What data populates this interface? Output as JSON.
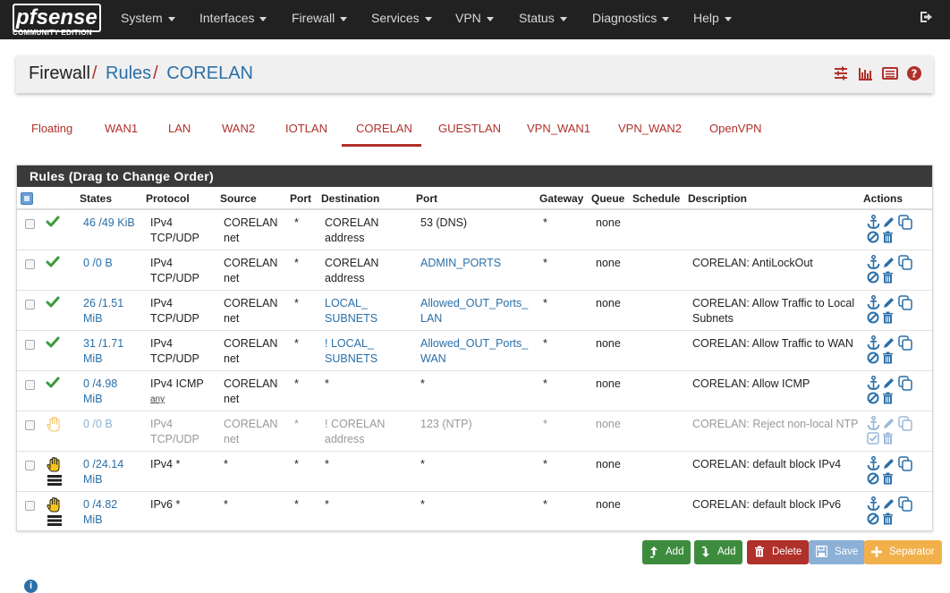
{
  "brand": {
    "logo_text": "pfsense",
    "edition": "COMMUNITY EDITION"
  },
  "nav": [
    {
      "label": "System"
    },
    {
      "label": "Interfaces"
    },
    {
      "label": "Firewall"
    },
    {
      "label": "Services"
    },
    {
      "label": "VPN"
    },
    {
      "label": "Status"
    },
    {
      "label": "Diagnostics"
    },
    {
      "label": "Help"
    }
  ],
  "breadcrumb": {
    "root": "Firewall",
    "section": "Rules",
    "current": "CORELAN"
  },
  "tabs": [
    "Floating",
    "WAN1",
    "LAN",
    "WAN2",
    "IOTLAN",
    "CORELAN",
    "GUESTLAN",
    "VPN_WAN1",
    "VPN_WAN2",
    "OpenVPN"
  ],
  "active_tab": "CORELAN",
  "panel_title": "Rules (Drag to Change Order)",
  "columns": {
    "states": "States",
    "protocol": "Protocol",
    "source": "Source",
    "port": "Port",
    "destination": "Destination",
    "dport": "Port",
    "gateway": "Gateway",
    "queue": "Queue",
    "schedule": "Schedule",
    "description": "Description",
    "actions": "Actions"
  },
  "rules": [
    {
      "status": "pass",
      "states1": "46 /49 KiB",
      "states2": "",
      "proto1": "IPv4",
      "proto2": "TCP/UDP",
      "src1": "CORELAN",
      "src2": "net",
      "sport": "*",
      "dst1": "CORELAN",
      "dst2": "address",
      "dport1": "53 (DNS)",
      "dport2": "",
      "gateway": "*",
      "queue": "none",
      "desc1": "",
      "desc2": ""
    },
    {
      "status": "pass",
      "states1": "0 /0 B",
      "states2": "",
      "proto1": "IPv4",
      "proto2": "TCP/UDP",
      "src1": "CORELAN",
      "src2": "net",
      "sport": "*",
      "dst1": "CORELAN",
      "dst2": "address",
      "dport1": "ADMIN_PORTS",
      "dport2": "",
      "gateway": "*",
      "queue": "none",
      "desc1": "CORELAN: AntiLockOut",
      "desc2": ""
    },
    {
      "status": "pass",
      "states1": "26 /1.51",
      "states2": "MiB",
      "proto1": "IPv4",
      "proto2": "TCP/UDP",
      "src1": "CORELAN",
      "src2": "net",
      "sport": "*",
      "dst1": "LOCAL_",
      "dst2": "SUBNETS",
      "dport1": "Allowed_OUT_Ports_",
      "dport2": "LAN",
      "gateway": "*",
      "queue": "none",
      "desc1": "CORELAN: Allow Traffic to Local",
      "desc2": "Subnets"
    },
    {
      "status": "pass",
      "states1": "31 /1.71",
      "states2": "MiB",
      "proto1": "IPv4",
      "proto2": "TCP/UDP",
      "src1": "CORELAN",
      "src2": "net",
      "sport": "*",
      "dst1": "! LOCAL_",
      "dst2": "SUBNETS",
      "dport1": "Allowed_OUT_Ports_",
      "dport2": "WAN",
      "gateway": "*",
      "queue": "none",
      "desc1": "CORELAN: Allow Traffic to WAN",
      "desc2": ""
    },
    {
      "status": "pass",
      "states1": "0 /4.98",
      "states2": "MiB",
      "proto1": "IPv4 ICMP",
      "proto2": "any",
      "src1": "CORELAN",
      "src2": "net",
      "sport": "*",
      "dst1": "*",
      "dst2": "",
      "dport1": "*",
      "dport2": "",
      "gateway": "*",
      "queue": "none",
      "desc1": "CORELAN: Allow ICMP",
      "desc2": ""
    },
    {
      "status": "reject-disabled",
      "states1": "0 /0 B",
      "states2": "",
      "proto1": "IPv4",
      "proto2": "TCP/UDP",
      "src1": "CORELAN",
      "src2": "net",
      "sport": "*",
      "dst1": "! CORELAN",
      "dst2": "address",
      "dport1": "123 (NTP)",
      "dport2": "",
      "gateway": "*",
      "queue": "none",
      "desc1": "CORELAN: Reject non-local NTP",
      "desc2": ""
    },
    {
      "status": "block-log",
      "states1": "0 /24.14",
      "states2": "MiB",
      "proto1": "IPv4 *",
      "proto2": "",
      "src1": "*",
      "src2": "",
      "sport": "*",
      "dst1": "*",
      "dst2": "",
      "dport1": "*",
      "dport2": "",
      "gateway": "*",
      "queue": "none",
      "desc1": "CORELAN: default block IPv4",
      "desc2": ""
    },
    {
      "status": "block-log",
      "states1": "0 /4.82",
      "states2": "MiB",
      "proto1": "IPv6 *",
      "proto2": "",
      "src1": "*",
      "src2": "",
      "sport": "*",
      "dst1": "*",
      "dst2": "",
      "dport1": "*",
      "dport2": "",
      "gateway": "*",
      "queue": "none",
      "desc1": "CORELAN: default block IPv6",
      "desc2": ""
    }
  ],
  "buttons": {
    "add_top": "Add",
    "add_bottom": "Add",
    "delete": "Delete",
    "save": "Save",
    "separator": "Separator"
  },
  "colors": {
    "brand_red": "#b0302a",
    "link_blue": "#2a6fa8",
    "pass_green": "#3d9a3d",
    "block_yellow": "#e8b020"
  }
}
